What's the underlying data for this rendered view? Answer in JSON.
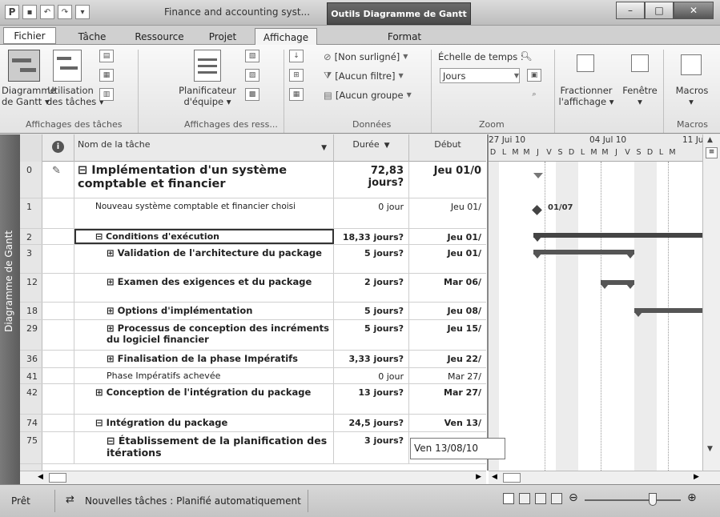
{
  "window": {
    "title": "Finance and accounting syst...",
    "tools_tab": "Outils Diagramme de Gantt",
    "qat_app_icon": "P",
    "min": "–",
    "max": "□",
    "close": "✕"
  },
  "tabs": {
    "fichier": "Fichier",
    "tache": "Tâche",
    "ressource": "Ressource",
    "projet": "Projet",
    "affichage": "Affichage",
    "format": "Format"
  },
  "ribbon": {
    "diagramme_gantt_1": "Diagramme",
    "diagramme_gantt_2": "de Gantt ▾",
    "utilisation_1": "Utilisation",
    "utilisation_2": "des tâches ▾",
    "planificateur_1": "Planificateur",
    "planificateur_2": "d'équipe ▾",
    "surlignage": "[Non surligné]",
    "filtre": "[Aucun filtre]",
    "groupe": "[Aucun groupe",
    "echelle_label": "Échelle de temps :",
    "echelle_value": "Jours",
    "fractionner_1": "Fractionner",
    "fractionner_2": "l'affichage ▾",
    "fenetre": "Fenêtre",
    "macros": "Macros",
    "group_affichages_taches": "Affichages des tâches",
    "group_affichages_ress": "Affichages des ress...",
    "group_donnees": "Données",
    "group_zoom": "Zoom",
    "group_macros": "Macros"
  },
  "vertical_tab": "Diagramme de Gantt",
  "columns": {
    "name": "Nom de la tâche",
    "duration": "Durée",
    "start": "Début"
  },
  "gantt_header": {
    "week1": "27 Jui 10",
    "week2": "04 Jul 10",
    "week3": "11 Jul",
    "days": [
      "D",
      "L",
      "M",
      "M",
      "J",
      "V",
      "S",
      "D",
      "L",
      "M",
      "M",
      "J",
      "V",
      "S",
      "D",
      "L",
      "M"
    ]
  },
  "milestone_label": "01/07",
  "rows": [
    {
      "id": "0",
      "name": "⊟ Implémentation d'un système comptable et financier",
      "duration": "72,83 jours?",
      "start": "Jeu 01/0"
    },
    {
      "id": "1",
      "name": "Nouveau système comptable et financier choisi",
      "duration": "0 jour",
      "start": "Jeu 01/"
    },
    {
      "id": "2",
      "name": "⊟ Conditions d'exécution",
      "duration": "18,33 jours?",
      "start": "Jeu 01/"
    },
    {
      "id": "3",
      "name": "⊞ Validation de l'architecture du package",
      "duration": "5 jours?",
      "start": "Jeu 01/"
    },
    {
      "id": "12",
      "name": "⊞ Examen des exigences et du package",
      "duration": "2 jours?",
      "start": "Mar 06/"
    },
    {
      "id": "18",
      "name": "⊞ Options d'implémentation",
      "duration": "5 jours?",
      "start": "Jeu 08/"
    },
    {
      "id": "29",
      "name": "⊞ Processus de conception des incréments du logiciel financier",
      "duration": "5 jours?",
      "start": "Jeu 15/"
    },
    {
      "id": "36",
      "name": "⊞ Finalisation de la phase Impératifs",
      "duration": "3,33 jours?",
      "start": "Jeu 22/"
    },
    {
      "id": "41",
      "name": "Phase Impératifs achevée",
      "duration": "0 jour",
      "start": "Mar 27/"
    },
    {
      "id": "42",
      "name": "⊞ Conception de l'intégration du package",
      "duration": "13 jours?",
      "start": "Mar 27/"
    },
    {
      "id": "74",
      "name": "⊟ Intégration du package",
      "duration": "24,5 jours?",
      "start": "Ven 13/"
    },
    {
      "id": "75",
      "name": "⊟ Établissement de la planification des itérations",
      "duration": "3 jours?",
      "start": ""
    }
  ],
  "edit_popup": "Ven 13/08/10",
  "status": {
    "ready": "Prêt",
    "new_tasks": "Nouvelles tâches : Planifié automatiquement"
  }
}
